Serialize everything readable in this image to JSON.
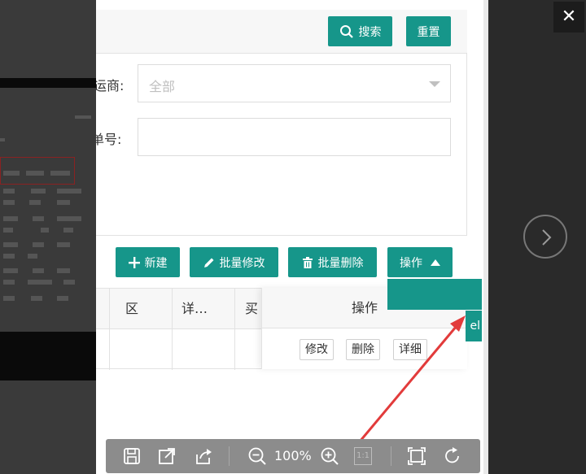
{
  "search_panel": {
    "search_label": "搜索",
    "reset_label": "重置"
  },
  "form": {
    "carrier_label": "运商:",
    "carrier_value": "全部",
    "number_label": "单号:",
    "number_value": ""
  },
  "toolbar": {
    "new_label": "新建",
    "batch_edit_label": "批量修改",
    "batch_delete_label": "批量删除",
    "actions_label": "操作"
  },
  "table": {
    "headers": [
      "区",
      "详…",
      "买"
    ],
    "fixed_header": "操作",
    "row_actions": [
      "修改",
      "删除",
      "详细"
    ]
  },
  "dropdown_peek_text": "el",
  "viewer": {
    "close_glyph": "✕",
    "zoom_level": "100%",
    "actual_size_label": "1:1"
  },
  "colors": {
    "accent": "#16968a",
    "overlay": "#2b2b2b",
    "arrow": "#e23b3b"
  },
  "icons": [
    "search-icon",
    "plus-icon",
    "pencil-icon",
    "trash-icon",
    "caret-up-icon",
    "close-icon",
    "chevron-right-icon",
    "save-icon",
    "open-in-new-icon",
    "share-icon",
    "zoom-out-icon",
    "zoom-in-icon",
    "fullscreen-icon",
    "rotate-icon"
  ]
}
